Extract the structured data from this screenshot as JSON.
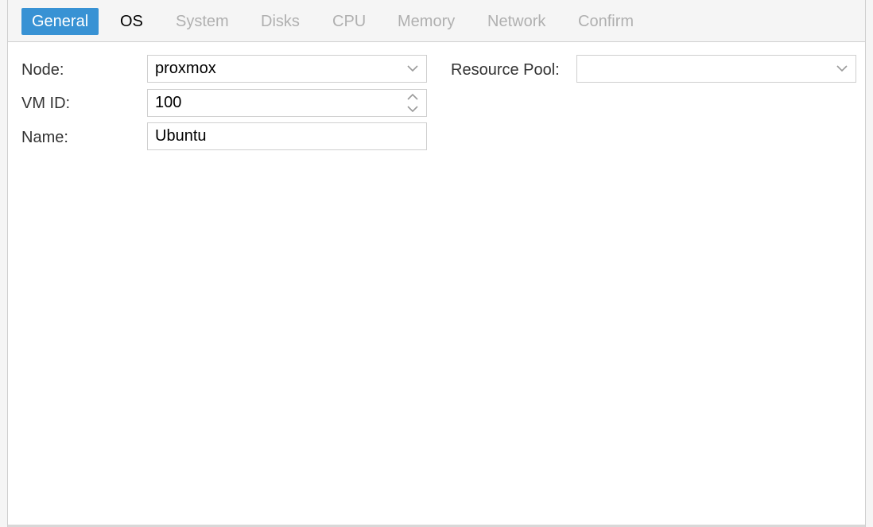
{
  "tabs": [
    {
      "label": "General",
      "state": "active"
    },
    {
      "label": "OS",
      "state": "enabled"
    },
    {
      "label": "System",
      "state": "disabled"
    },
    {
      "label": "Disks",
      "state": "disabled"
    },
    {
      "label": "CPU",
      "state": "disabled"
    },
    {
      "label": "Memory",
      "state": "disabled"
    },
    {
      "label": "Network",
      "state": "disabled"
    },
    {
      "label": "Confirm",
      "state": "disabled"
    }
  ],
  "form": {
    "node": {
      "label": "Node:",
      "value": "proxmox"
    },
    "vmid": {
      "label": "VM ID:",
      "value": "100"
    },
    "name": {
      "label": "Name:",
      "value": "Ubuntu"
    },
    "pool": {
      "label": "Resource Pool:",
      "value": ""
    }
  },
  "icons": {
    "dropdown": "chevron-down-icon",
    "spinner": "spinner-arrows-icon"
  },
  "colors": {
    "active_tab": "#3892d4",
    "disabled_tab_text": "#b0b0b0",
    "field_border": "#cfcfcf"
  }
}
